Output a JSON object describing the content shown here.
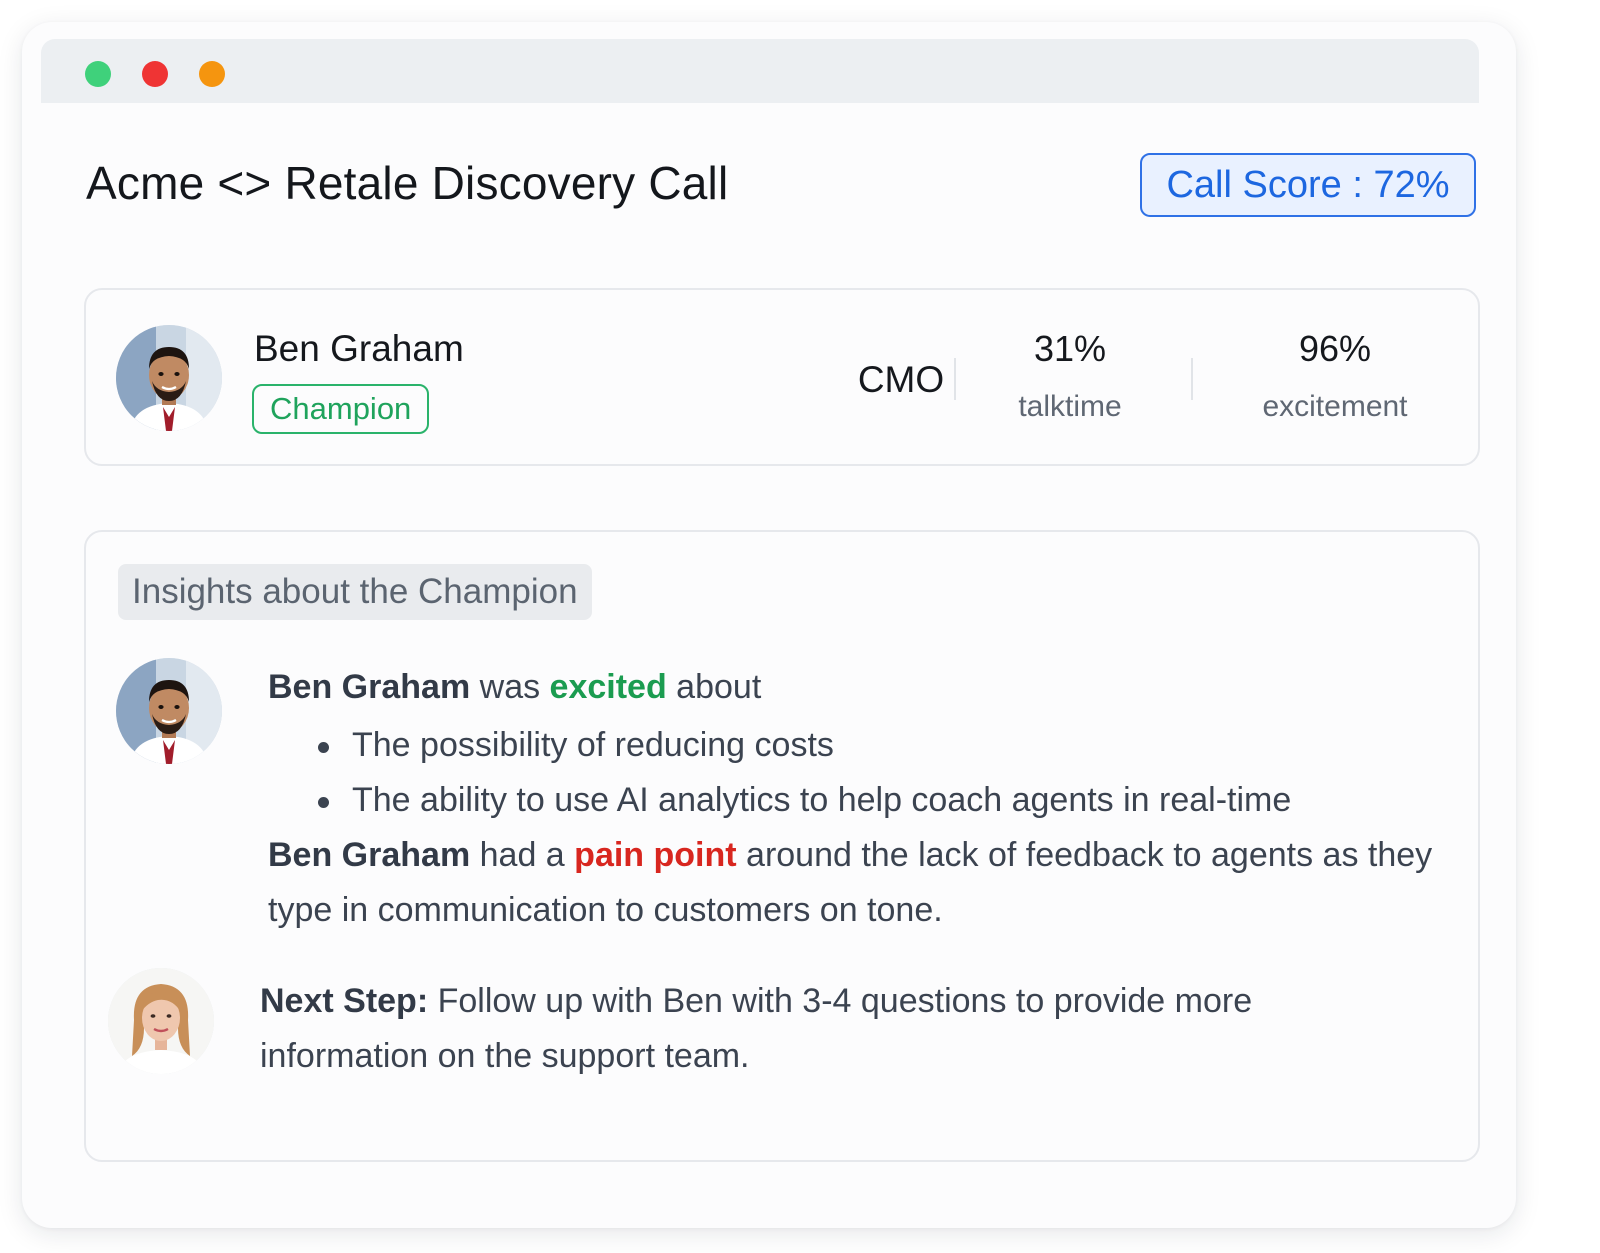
{
  "window": {
    "controls": [
      "close",
      "minimize",
      "maximize"
    ],
    "dot_colors": [
      "#3fd17b",
      "#ef3434",
      "#f5950f"
    ]
  },
  "header": {
    "title": "Acme <> Retale Discovery Call",
    "call_score": "Call Score : 72%"
  },
  "person": {
    "name": "Ben Graham",
    "role_badge": "Champion",
    "title": "CMO",
    "metrics": [
      {
        "value": "31%",
        "label": "talktime"
      },
      {
        "value": "96%",
        "label": "excitement"
      }
    ]
  },
  "insights": {
    "tag": "Insights about the Champion",
    "excited": {
      "name": "Ben Graham",
      "connector": " was ",
      "keyword": "excited",
      "suffix": " about",
      "bullets": [
        "The possibility of reducing costs",
        "The ability to use AI analytics to help coach agents in real-time"
      ]
    },
    "pain": {
      "name": "Ben Graham",
      "connector": " had a ",
      "keyword": "pain point",
      "suffix": " around the lack of feedback to agents as they type in communication to customers on tone."
    },
    "next_step": {
      "label": "Next Step:",
      "text": " Follow up with Ben with 3-4 questions to provide more information on the support team."
    }
  },
  "colors": {
    "accent_blue": "#1d67e0",
    "champion_green": "#1fa35c",
    "excited_green": "#1b9c50",
    "pain_red": "#d8261f"
  }
}
